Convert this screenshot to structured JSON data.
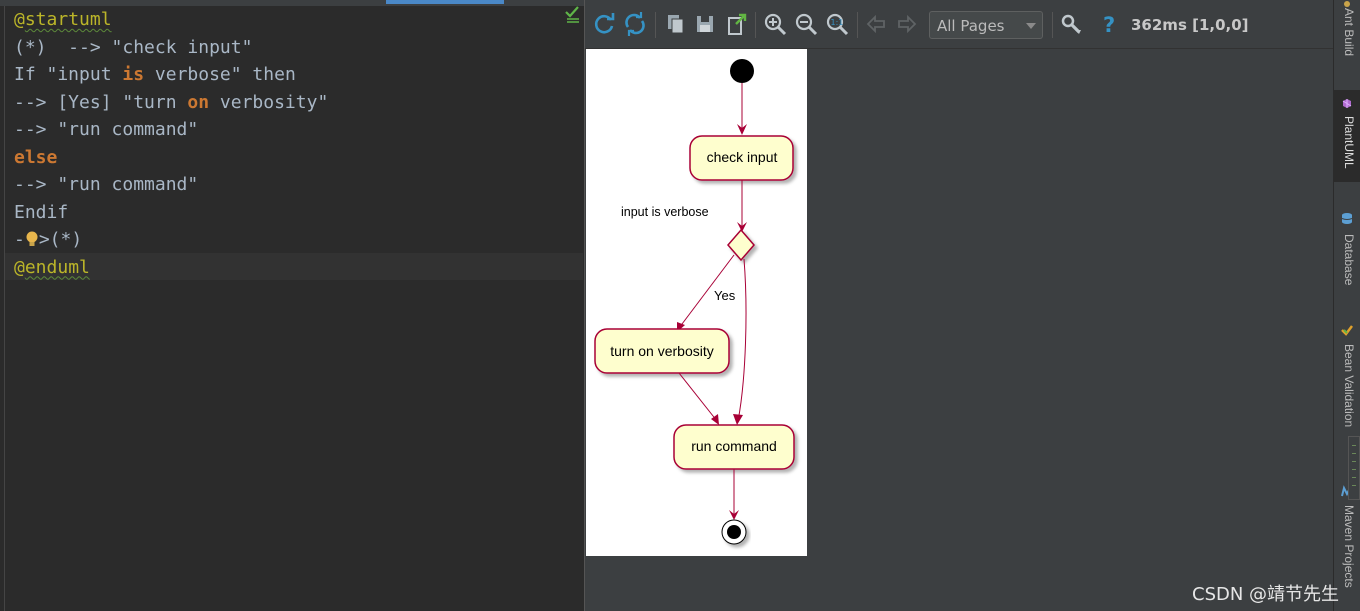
{
  "editor": {
    "lines": [
      [
        {
          "t": "@",
          "c": "at"
        },
        {
          "t": "startuml",
          "c": "ann"
        }
      ],
      [
        {
          "t": "(*)  --> \"check input\"",
          "c": ""
        }
      ],
      [
        {
          "t": "If \"input ",
          "c": ""
        },
        {
          "t": "is",
          "c": "kw"
        },
        {
          "t": " verbose\" then",
          "c": ""
        }
      ],
      [
        {
          "t": "--> [Yes] \"turn ",
          "c": ""
        },
        {
          "t": "on",
          "c": "kw"
        },
        {
          "t": " verbosity\"",
          "c": ""
        }
      ],
      [
        {
          "t": "--> \"run command\"",
          "c": ""
        }
      ],
      [
        {
          "t": "else",
          "c": "kw"
        }
      ],
      [
        {
          "t": "--> \"run command\"",
          "c": ""
        }
      ],
      [
        {
          "t": "Endif",
          "c": ""
        }
      ],
      [
        {
          "t": "-",
          "c": ""
        },
        {
          "t": "",
          "c": "bulb"
        },
        {
          "t": ">(*)",
          "c": ""
        }
      ],
      [
        {
          "t": "@",
          "c": "at"
        },
        {
          "t": "enduml",
          "c": "ann"
        }
      ]
    ]
  },
  "toolbar": {
    "pages_selected": "All Pages",
    "timing": "362ms [1,0,0]",
    "accent": "#3592c4"
  },
  "diagram": {
    "nodes": {
      "check_input": "check input",
      "decision_label": "input is verbose",
      "yes_label": "Yes",
      "turn_on": "turn on verbosity",
      "run_command": "run command"
    },
    "colors": {
      "activity_fill": "#fefece",
      "border": "#a80036",
      "arrow": "#a80036"
    }
  },
  "rightbar": {
    "tabs": [
      "Ant Build",
      "PlantUML",
      "Database",
      "Bean Validation",
      "Maven Projects"
    ]
  },
  "watermark": "CSDN @靖节先生"
}
